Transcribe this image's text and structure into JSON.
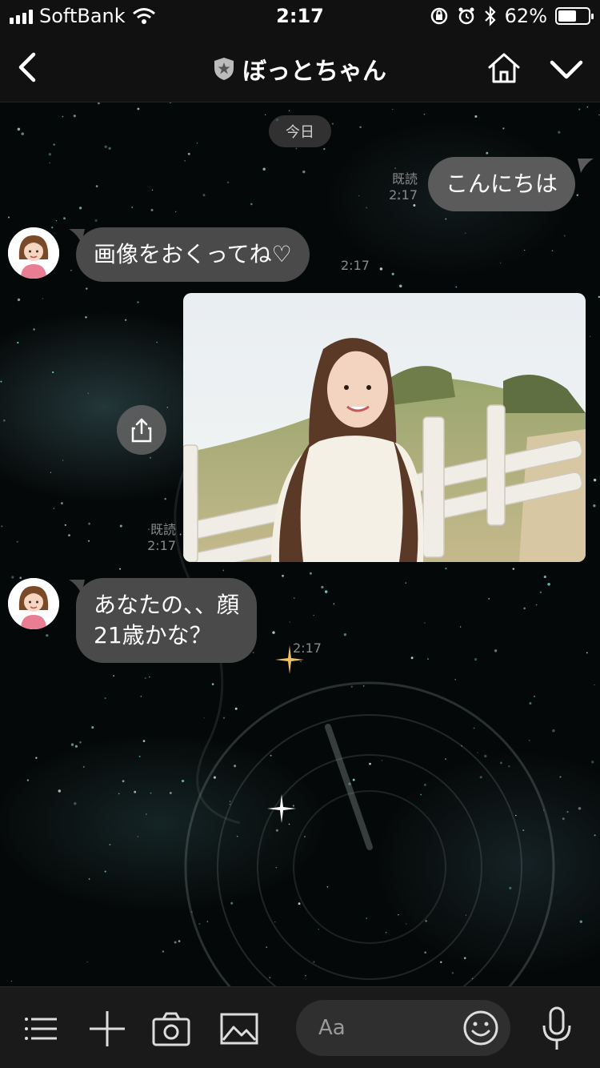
{
  "status_bar": {
    "carrier": "SoftBank",
    "time": "2:17",
    "battery_text": "62%",
    "battery_level": 0.62
  },
  "header": {
    "title": "ぼっとちゃん"
  },
  "chat": {
    "date_label": "今日",
    "messages": [
      {
        "sender": "me",
        "text": "こんにちは",
        "read_label": "既読",
        "time": "2:17"
      },
      {
        "sender": "bot",
        "text": "画像をおくってね♡",
        "time": "2:17"
      },
      {
        "sender": "me",
        "type": "image",
        "read_label": "既読",
        "time": "2:17"
      },
      {
        "sender": "bot",
        "lines": [
          "あなたの、、顔",
          "21歳かな？"
        ],
        "time": "2:17"
      }
    ]
  },
  "input": {
    "placeholder": "Aa"
  },
  "icons": {
    "back": "back-arrow-icon",
    "badge": "shield-star-icon",
    "home": "home-icon",
    "dropdown": "chevron-down-icon",
    "share": "share-icon",
    "menu": "menu-icon",
    "add": "plus-icon",
    "camera": "camera-icon",
    "gallery": "image-icon",
    "emoji": "smiley-icon",
    "mic": "microphone-icon"
  },
  "colors": {
    "bar_bg": "#111111",
    "bubble_bg": "#4a4a4a",
    "bubble_out_bg": "#5b5b5b",
    "sky": "#e9eef2"
  }
}
